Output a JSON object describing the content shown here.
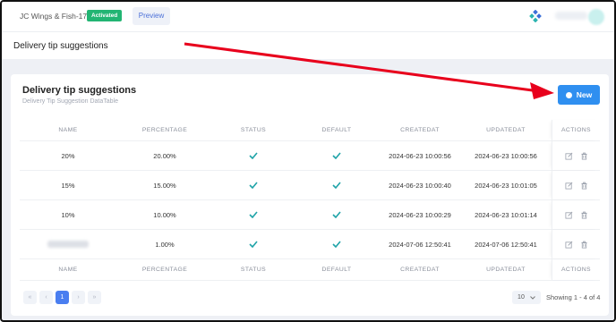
{
  "topbar": {
    "store_name": "JC Wings & Fish-174",
    "status_badge": "Activated",
    "preview_label": "Preview"
  },
  "page": {
    "title": "Delivery tip suggestions"
  },
  "card": {
    "title": "Delivery tip suggestions",
    "subtitle": "Delivery Tip Suggestion DataTable",
    "new_label": "New"
  },
  "table": {
    "columns": [
      "NAME",
      "PERCENTAGE",
      "STATUS",
      "DEFAULT",
      "CREATEDAT",
      "UPDATEDAT",
      "ACTIONS"
    ],
    "rows": [
      {
        "name": "20%",
        "percentage": "20.00%",
        "status": true,
        "default": true,
        "created": "2024-06-23 10:00:56",
        "updated": "2024-06-23 10:00:56"
      },
      {
        "name": "15%",
        "percentage": "15.00%",
        "status": true,
        "default": true,
        "created": "2024-06-23 10:00:40",
        "updated": "2024-06-23 10:01:05"
      },
      {
        "name": "10%",
        "percentage": "10.00%",
        "status": true,
        "default": true,
        "created": "2024-06-23 10:00:29",
        "updated": "2024-06-23 10:01:14"
      },
      {
        "name": "",
        "percentage": "1.00%",
        "status": true,
        "default": true,
        "created": "2024-07-06 12:50:41",
        "updated": "2024-07-06 12:50:41"
      }
    ]
  },
  "pagination": {
    "first": "«",
    "prev": "‹",
    "current": "1",
    "next": "›",
    "last": "»",
    "per_page": "10",
    "showing": "Showing 1 - 4 of 4"
  },
  "colors": {
    "accent": "#2f8ff0",
    "badge": "#22b573",
    "check": "#1fa3a8",
    "arrow": "#e8001c"
  }
}
